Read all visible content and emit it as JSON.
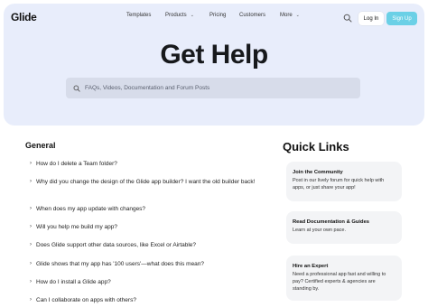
{
  "brand": {
    "logo": "Glide"
  },
  "nav": {
    "templates": "Templates",
    "products": "Products",
    "pricing": "Pricing",
    "customers": "Customers",
    "more": "More"
  },
  "header_actions": {
    "login": "Log In",
    "signup": "Sign Up"
  },
  "hero": {
    "title": "Get Help",
    "search_placeholder": "FAQs, Videos, Documentation and Forum Posts"
  },
  "general": {
    "title": "General",
    "items": [
      "How do I delete a Team folder?",
      "Why did you change the design of the Glide app builder? I want the old builder back!",
      "When does my app update with changes?",
      "Will you help me build my app?",
      "Does Glide support other data sources, like Excel or Airtable?",
      "Glide shows that my app has '100 users'—what does this mean?",
      "How do I install a Glide app?",
      "Can I collaborate on apps with others?"
    ]
  },
  "quick_links": {
    "title": "Quick Links",
    "cards": [
      {
        "title": "Join the Community",
        "desc": "Post in our lively forum for quick help with apps, or just share your app!"
      },
      {
        "title": "Read Documentation & Guides",
        "desc": "Learn at your own pace."
      },
      {
        "title": "Hire an Expert",
        "desc": "Need a professional app fast and willing to pay? Certified experts & agencies are standing by."
      }
    ]
  },
  "colors": {
    "hero_bg": "#e8edfb",
    "signup_bg": "#6bd0e6",
    "search_bg": "#d7dcea",
    "card_bg": "#f3f4f6"
  }
}
